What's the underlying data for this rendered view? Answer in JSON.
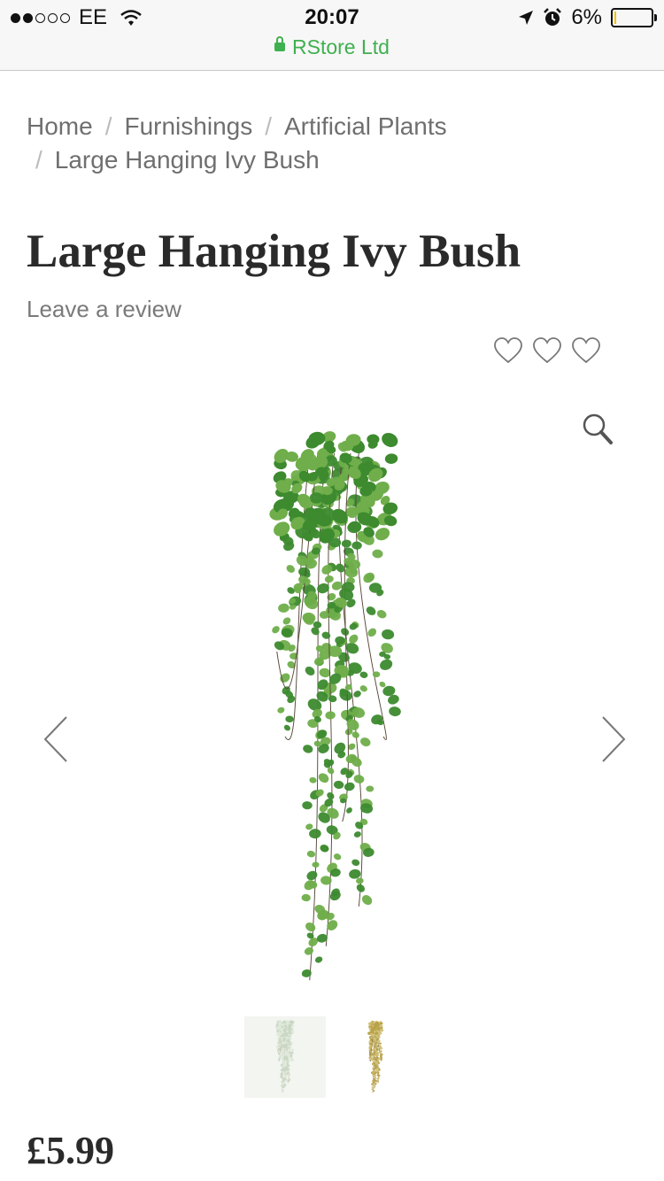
{
  "status_bar": {
    "carrier": "EE",
    "signal_bars_filled": 2,
    "signal_bars_total": 5,
    "time": "20:07",
    "battery_percent_label": "6%",
    "battery_level": 0.06,
    "url": "RStore Ltd",
    "icons": [
      "wifi-icon",
      "location-arrow-icon",
      "alarm-icon",
      "battery-icon",
      "lock-icon"
    ]
  },
  "breadcrumb": {
    "items": [
      "Home",
      "Furnishings",
      "Artificial Plants",
      "Large Hanging Ivy Bush"
    ],
    "separator": "/"
  },
  "product": {
    "title": "Large Hanging Ivy Bush",
    "review_link": "Leave a review",
    "rating_icons": [
      "heart-icon",
      "heart-icon",
      "heart-icon"
    ],
    "price": "£5.99",
    "image_count": 2
  },
  "colors": {
    "secure_green": "#3fb04f",
    "battery_low": "#f2c200",
    "leaf_green": "#3d8a2f",
    "text_dark": "#2a2a2a",
    "text_grey": "#6f6f6f"
  }
}
